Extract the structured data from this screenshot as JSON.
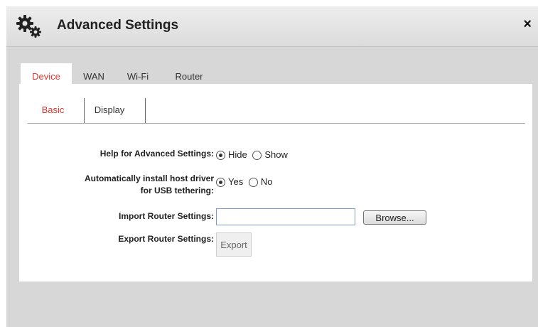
{
  "dialog": {
    "title": "Advanced Settings",
    "close_glyph": "×"
  },
  "tabs": [
    {
      "label": "Device",
      "active": true
    },
    {
      "label": "WAN",
      "active": false
    },
    {
      "label": "Wi-Fi",
      "active": false
    },
    {
      "label": "Router",
      "active": false
    }
  ],
  "subtabs": [
    {
      "label": "Basic",
      "active": true
    },
    {
      "label": "Display",
      "active": false
    }
  ],
  "form": {
    "help": {
      "label": "Help for Advanced Settings:",
      "options": [
        {
          "label": "Hide",
          "selected": true
        },
        {
          "label": "Show",
          "selected": false
        }
      ]
    },
    "usb": {
      "label_line1": "Automatically install host driver",
      "label_line2": "for USB tethering:",
      "options": [
        {
          "label": "Yes",
          "selected": true
        },
        {
          "label": "No",
          "selected": false
        }
      ]
    },
    "import": {
      "label": "Import Router Settings:",
      "value": "",
      "browse_label": "Browse..."
    },
    "export": {
      "label": "Export Router Settings:",
      "button_label": "Export"
    }
  },
  "colors": {
    "accent": "#d9372e",
    "background": "#d7d7d7",
    "panel": "#ffffff"
  },
  "icons": {
    "title": "gears-icon",
    "close": "close-icon"
  }
}
